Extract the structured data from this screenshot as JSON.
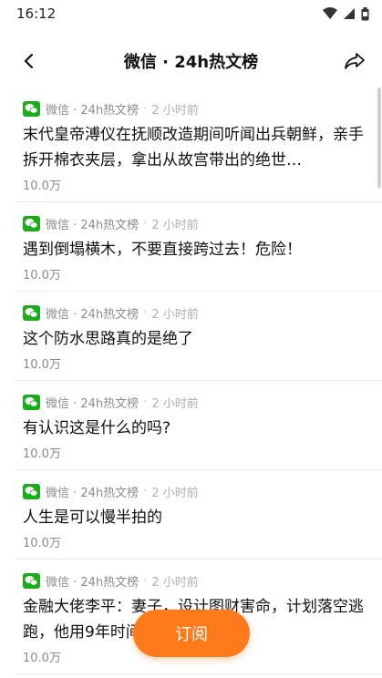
{
  "status_bar": {
    "time": "16:12"
  },
  "header": {
    "title": "微信 · 24h热文榜"
  },
  "articles": [
    {
      "source": "微信 · 24h热文榜",
      "time": "2 小时前",
      "title": "末代皇帝溥仪在抚顺改造期间听闻出兵朝鲜，亲手拆开棉衣夹层，拿出从故宫带出的绝世…",
      "views": "10.0万"
    },
    {
      "source": "微信 · 24h热文榜",
      "time": "2 小时前",
      "title": "遇到倒塌横木，不要直接跨过去！危险！",
      "views": "10.0万"
    },
    {
      "source": "微信 · 24h热文榜",
      "time": "2 小时前",
      "title": "这个防水思路真的是绝了",
      "views": "10.0万"
    },
    {
      "source": "微信 · 24h热文榜",
      "time": "2 小时前",
      "title": "有认识这是什么的吗?",
      "views": "10.0万"
    },
    {
      "source": "微信 · 24h热文榜",
      "time": "2 小时前",
      "title": "人生是可以慢半拍的",
      "views": "10.0万"
    },
    {
      "source": "微信 · 24h热文榜",
      "time": "2 小时前",
      "title": "金融大佬李平：妻子，设计图财害命，计划落空逃跑，他用9年时间让她受到…",
      "views": "10.0万"
    }
  ],
  "subscribe_button": {
    "label": "订阅"
  },
  "colors": {
    "accent": "#ff7a1a",
    "wechat_green": "#1aad19"
  }
}
